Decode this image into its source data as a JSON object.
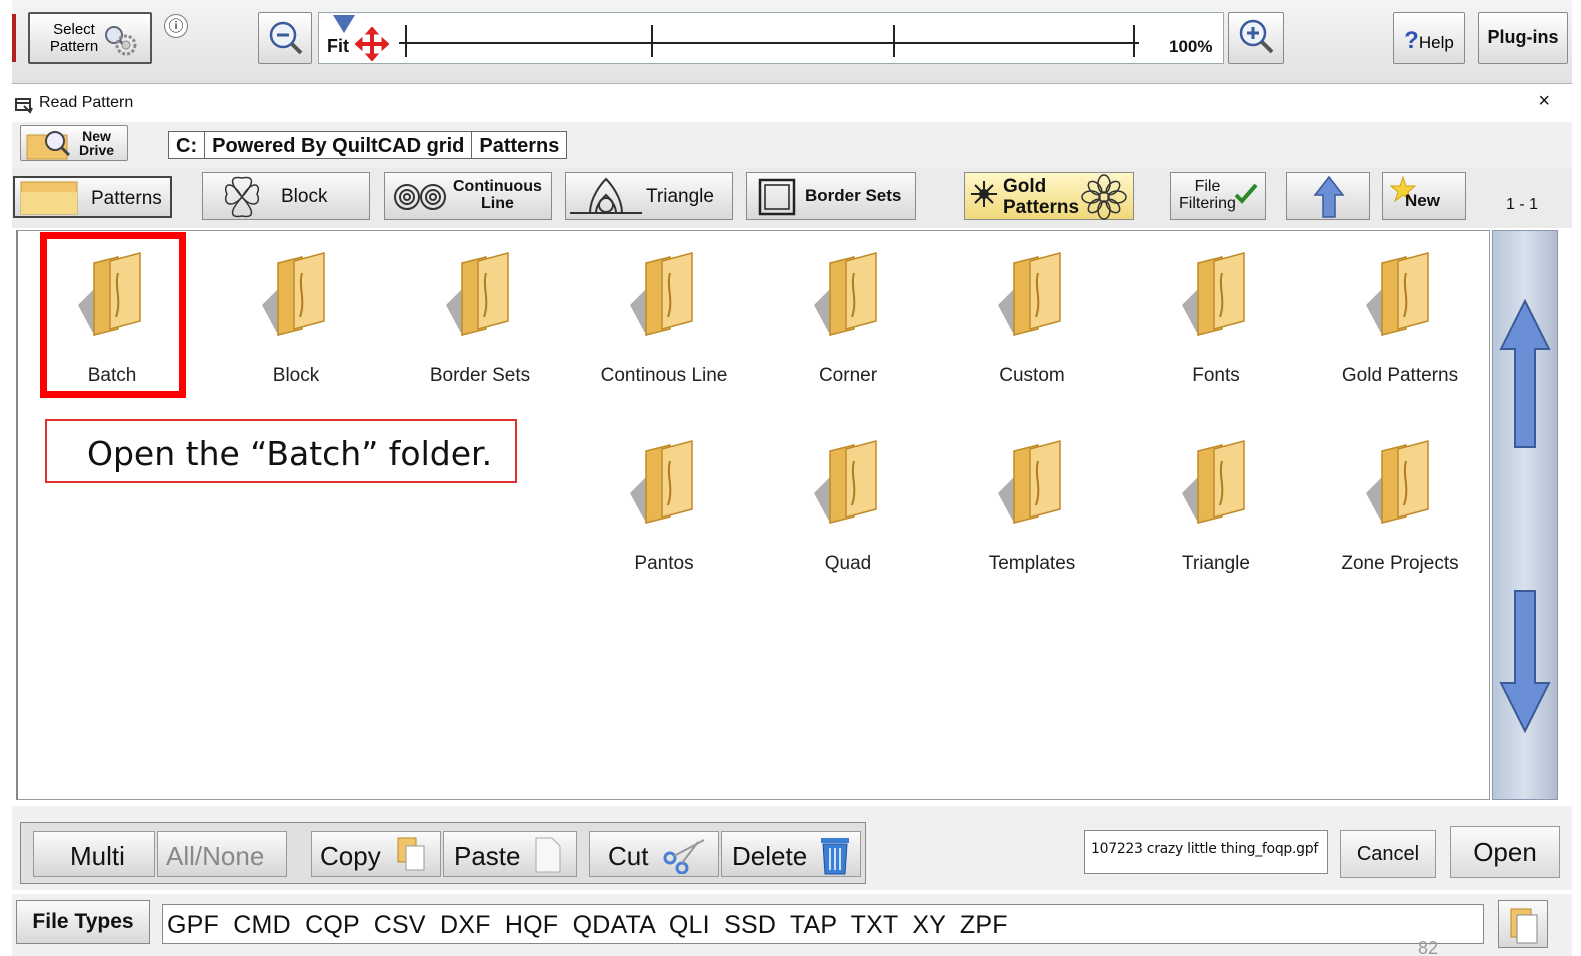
{
  "toolbar": {
    "select_pattern_label": "Select\nPattern",
    "info_label": "ⓘ",
    "fit_label": "Fit",
    "zoom_percent": "100%",
    "help_label": "Help",
    "plugins_label": "Plug-ins"
  },
  "dialog": {
    "title": "Read Pattern",
    "close": "×"
  },
  "path_row": {
    "new_drive_label": "New\nDrive",
    "breadcrumbs": [
      "C:",
      "Powered By QuiltCAD grid",
      "Patterns"
    ]
  },
  "categories": {
    "patterns": "Patterns",
    "block": "Block",
    "continuous_line": "Continuous\nLine",
    "triangle": "Triangle",
    "border_sets": "Border Sets",
    "gold_patterns": "Gold\nPatterns",
    "file_filtering": "File\nFiltering",
    "new": "New",
    "page_count": "1 - 1"
  },
  "folders": [
    "Batch",
    "Block",
    "Border Sets",
    "Continous Line",
    "Corner",
    "Custom",
    "Fonts",
    "Gold Patterns",
    "Pantos",
    "Quad",
    "Templates",
    "Triangle",
    "Zone Projects"
  ],
  "callout": {
    "text": "Open the “Batch” folder."
  },
  "actions": {
    "multi": "Multi",
    "all_none": "All/None",
    "copy": "Copy",
    "paste": "Paste",
    "cut": "Cut",
    "delete": "Delete",
    "filename_value": "107223 crazy little thing_foqp.gpf",
    "cancel": "Cancel",
    "open": "Open"
  },
  "file_types": {
    "label": "File Types",
    "value": "GPF  CMD  CQP  CSV  DXF  HQF  QDATA  QLI  SSD  TAP  TXT  XY  ZPF"
  },
  "colors": {
    "highlight": "#ff0000",
    "folder": "#f2c46a",
    "scroll_arrow": "#5b7fc4"
  },
  "page_number": "82"
}
